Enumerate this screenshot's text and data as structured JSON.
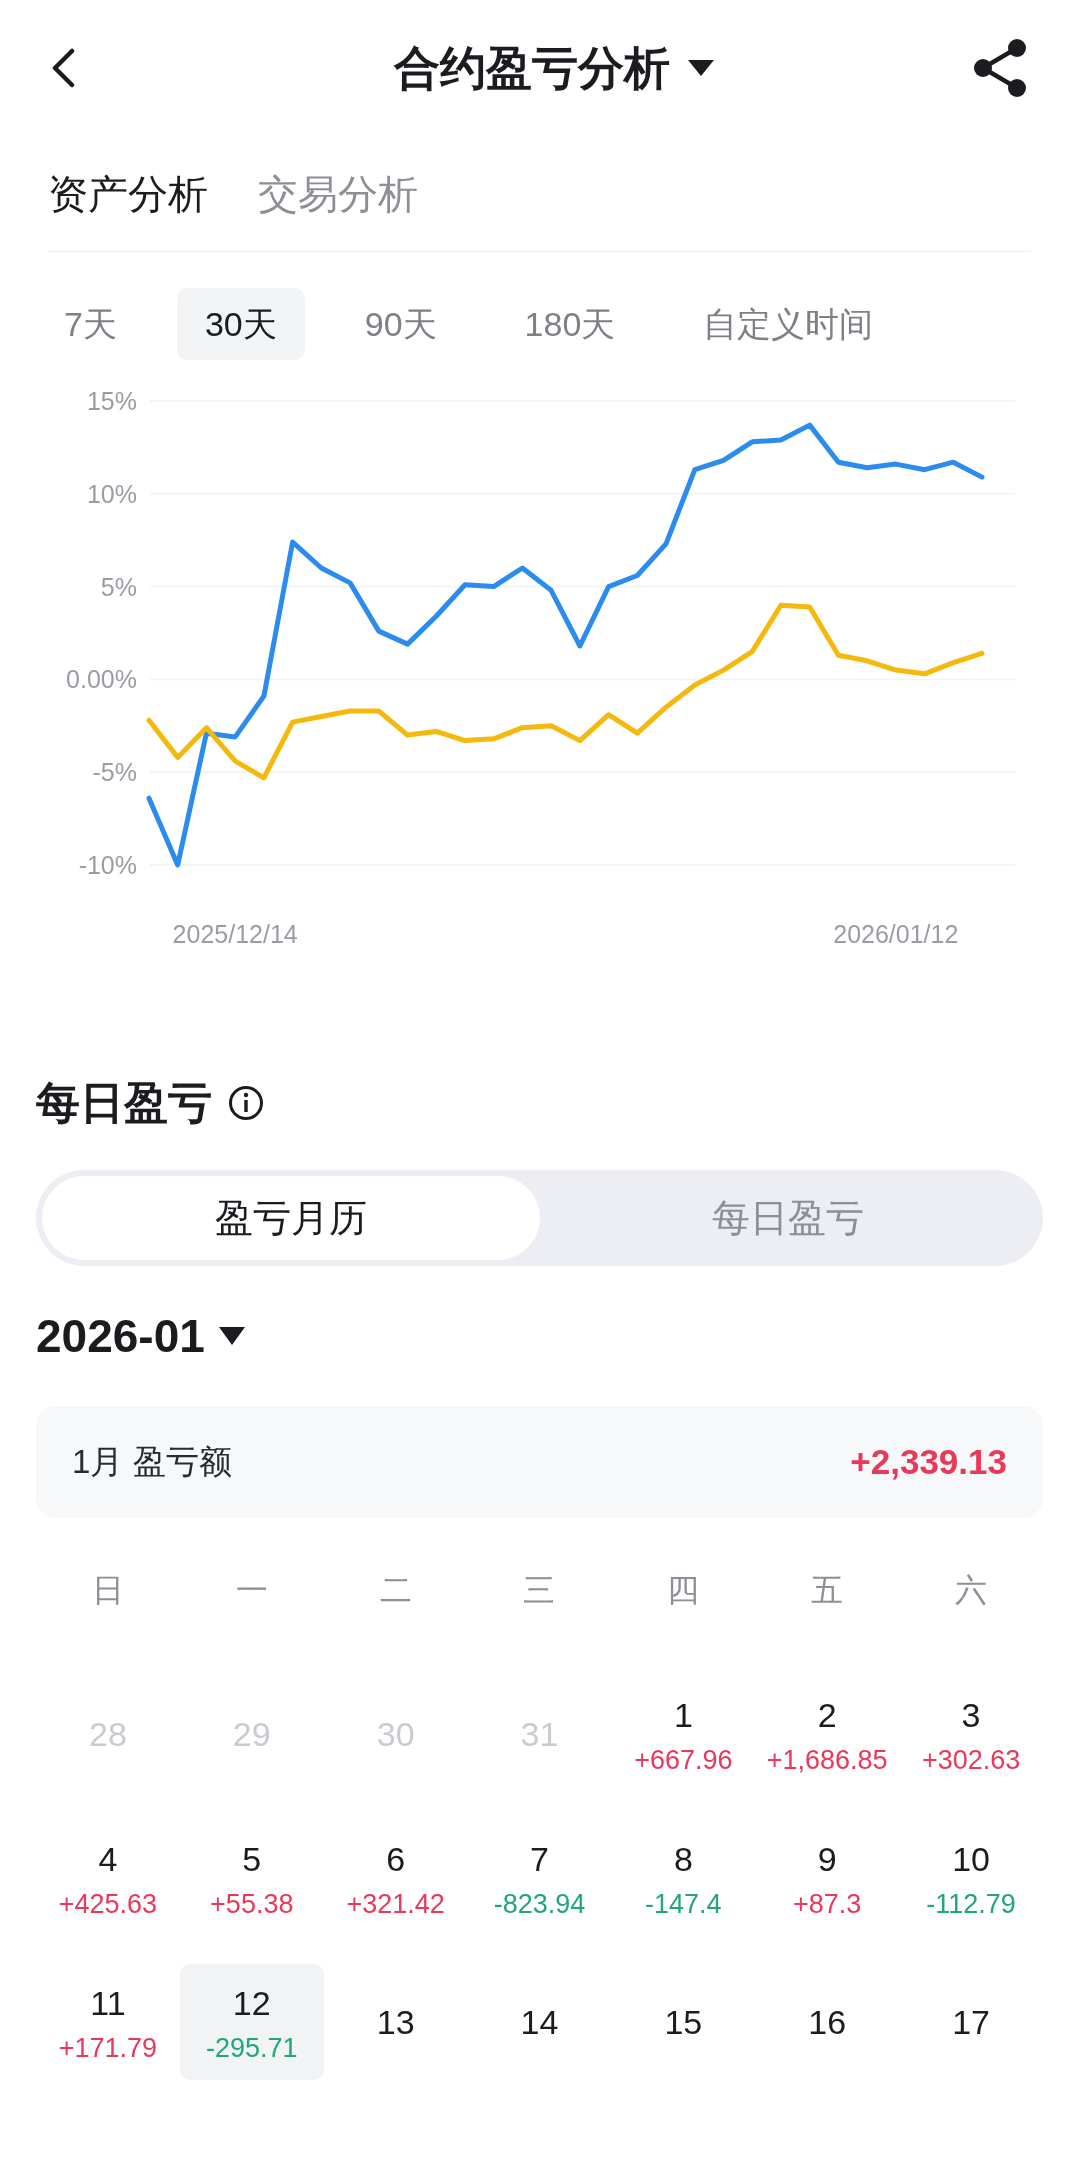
{
  "header": {
    "title": "合约盈亏分析"
  },
  "tabs": [
    {
      "label": "资产分析",
      "selected": true
    },
    {
      "label": "交易分析",
      "selected": false
    }
  ],
  "ranges": [
    {
      "label": "7天",
      "selected": false
    },
    {
      "label": "30天",
      "selected": true
    },
    {
      "label": "90天",
      "selected": false
    },
    {
      "label": "180天",
      "selected": false
    },
    {
      "label": "自定义时间",
      "selected": false
    }
  ],
  "chart_data": {
    "type": "line",
    "grid": true,
    "ylim": [
      -10,
      15
    ],
    "yticks": [
      {
        "value": 15,
        "label": "15%"
      },
      {
        "value": 10,
        "label": "10%"
      },
      {
        "value": 5,
        "label": "5%"
      },
      {
        "value": 0,
        "label": "0.00%"
      },
      {
        "value": -5,
        "label": "-5%"
      },
      {
        "value": -10,
        "label": "-10%"
      }
    ],
    "categories": [
      null,
      null,
      null,
      "2025/12/14",
      null,
      null,
      null,
      null,
      null,
      null,
      null,
      null,
      null,
      null,
      null,
      null,
      null,
      null,
      null,
      null,
      null,
      null,
      null,
      null,
      null,
      null,
      "2026/01/12",
      null,
      null,
      null
    ],
    "series": [
      {
        "color": "#2b8cee",
        "values": [
          -6.4,
          -10.0,
          -2.9,
          -3.1,
          -0.9,
          7.4,
          6.0,
          5.2,
          2.6,
          1.9,
          3.4,
          5.1,
          5.0,
          6.0,
          4.8,
          1.8,
          5.0,
          5.6,
          7.3,
          11.3,
          11.8,
          12.8,
          12.9,
          13.7,
          11.7,
          11.4,
          11.6,
          11.3,
          11.7,
          10.9
        ]
      },
      {
        "color": "#f5b80c",
        "values": [
          -2.2,
          -4.2,
          -2.6,
          -4.4,
          -5.3,
          -2.3,
          -2.0,
          -1.7,
          -1.7,
          -3.0,
          -2.8,
          -3.3,
          -3.2,
          -2.6,
          -2.5,
          -3.3,
          -1.9,
          -2.9,
          -1.5,
          -0.3,
          0.5,
          1.5,
          4.0,
          3.9,
          1.3,
          1.0,
          0.5,
          0.3,
          0.9,
          1.4
        ]
      }
    ]
  },
  "daily": {
    "title": "每日盈亏",
    "segments": [
      {
        "label": "盈亏月历",
        "selected": true
      },
      {
        "label": "每日盈亏",
        "selected": false
      }
    ],
    "month": "2026-01",
    "summary": {
      "label": "1月 盈亏额",
      "value": "+2,339.13"
    },
    "weekdays": [
      "日",
      "一",
      "二",
      "三",
      "四",
      "五",
      "六"
    ],
    "days": [
      {
        "day": "28",
        "muted": true,
        "selected": false
      },
      {
        "day": "29",
        "muted": true,
        "selected": false
      },
      {
        "day": "30",
        "muted": true,
        "selected": false
      },
      {
        "day": "31",
        "muted": true,
        "selected": false
      },
      {
        "day": "1",
        "muted": false,
        "selected": false,
        "amount": "+667.96",
        "color": "#e8395a"
      },
      {
        "day": "2",
        "muted": false,
        "selected": false,
        "amount": "+1,686.85",
        "color": "#e8395a"
      },
      {
        "day": "3",
        "muted": false,
        "selected": false,
        "amount": "+302.63",
        "color": "#e8395a"
      },
      {
        "day": "4",
        "muted": false,
        "selected": false,
        "amount": "+425.63",
        "color": "#e8395a"
      },
      {
        "day": "5",
        "muted": false,
        "selected": false,
        "amount": "+55.38",
        "color": "#e8395a"
      },
      {
        "day": "6",
        "muted": false,
        "selected": false,
        "amount": "+321.42",
        "color": "#e8395a"
      },
      {
        "day": "7",
        "muted": false,
        "selected": false,
        "amount": "-823.94",
        "color": "#1fa775"
      },
      {
        "day": "8",
        "muted": false,
        "selected": false,
        "amount": "-147.4",
        "color": "#1fa775"
      },
      {
        "day": "9",
        "muted": false,
        "selected": false,
        "amount": "+87.3",
        "color": "#e8395a"
      },
      {
        "day": "10",
        "muted": false,
        "selected": false,
        "amount": "-112.79",
        "color": "#1fa775"
      },
      {
        "day": "11",
        "muted": false,
        "selected": false,
        "amount": "+171.79",
        "color": "#e8395a"
      },
      {
        "day": "12",
        "muted": false,
        "selected": true,
        "amount": "-295.71",
        "color": "#1fa775"
      },
      {
        "day": "13",
        "muted": false,
        "selected": false
      },
      {
        "day": "14",
        "muted": false,
        "selected": false
      },
      {
        "day": "15",
        "muted": false,
        "selected": false
      },
      {
        "day": "16",
        "muted": false,
        "selected": false
      },
      {
        "day": "17",
        "muted": false,
        "selected": false
      }
    ]
  }
}
